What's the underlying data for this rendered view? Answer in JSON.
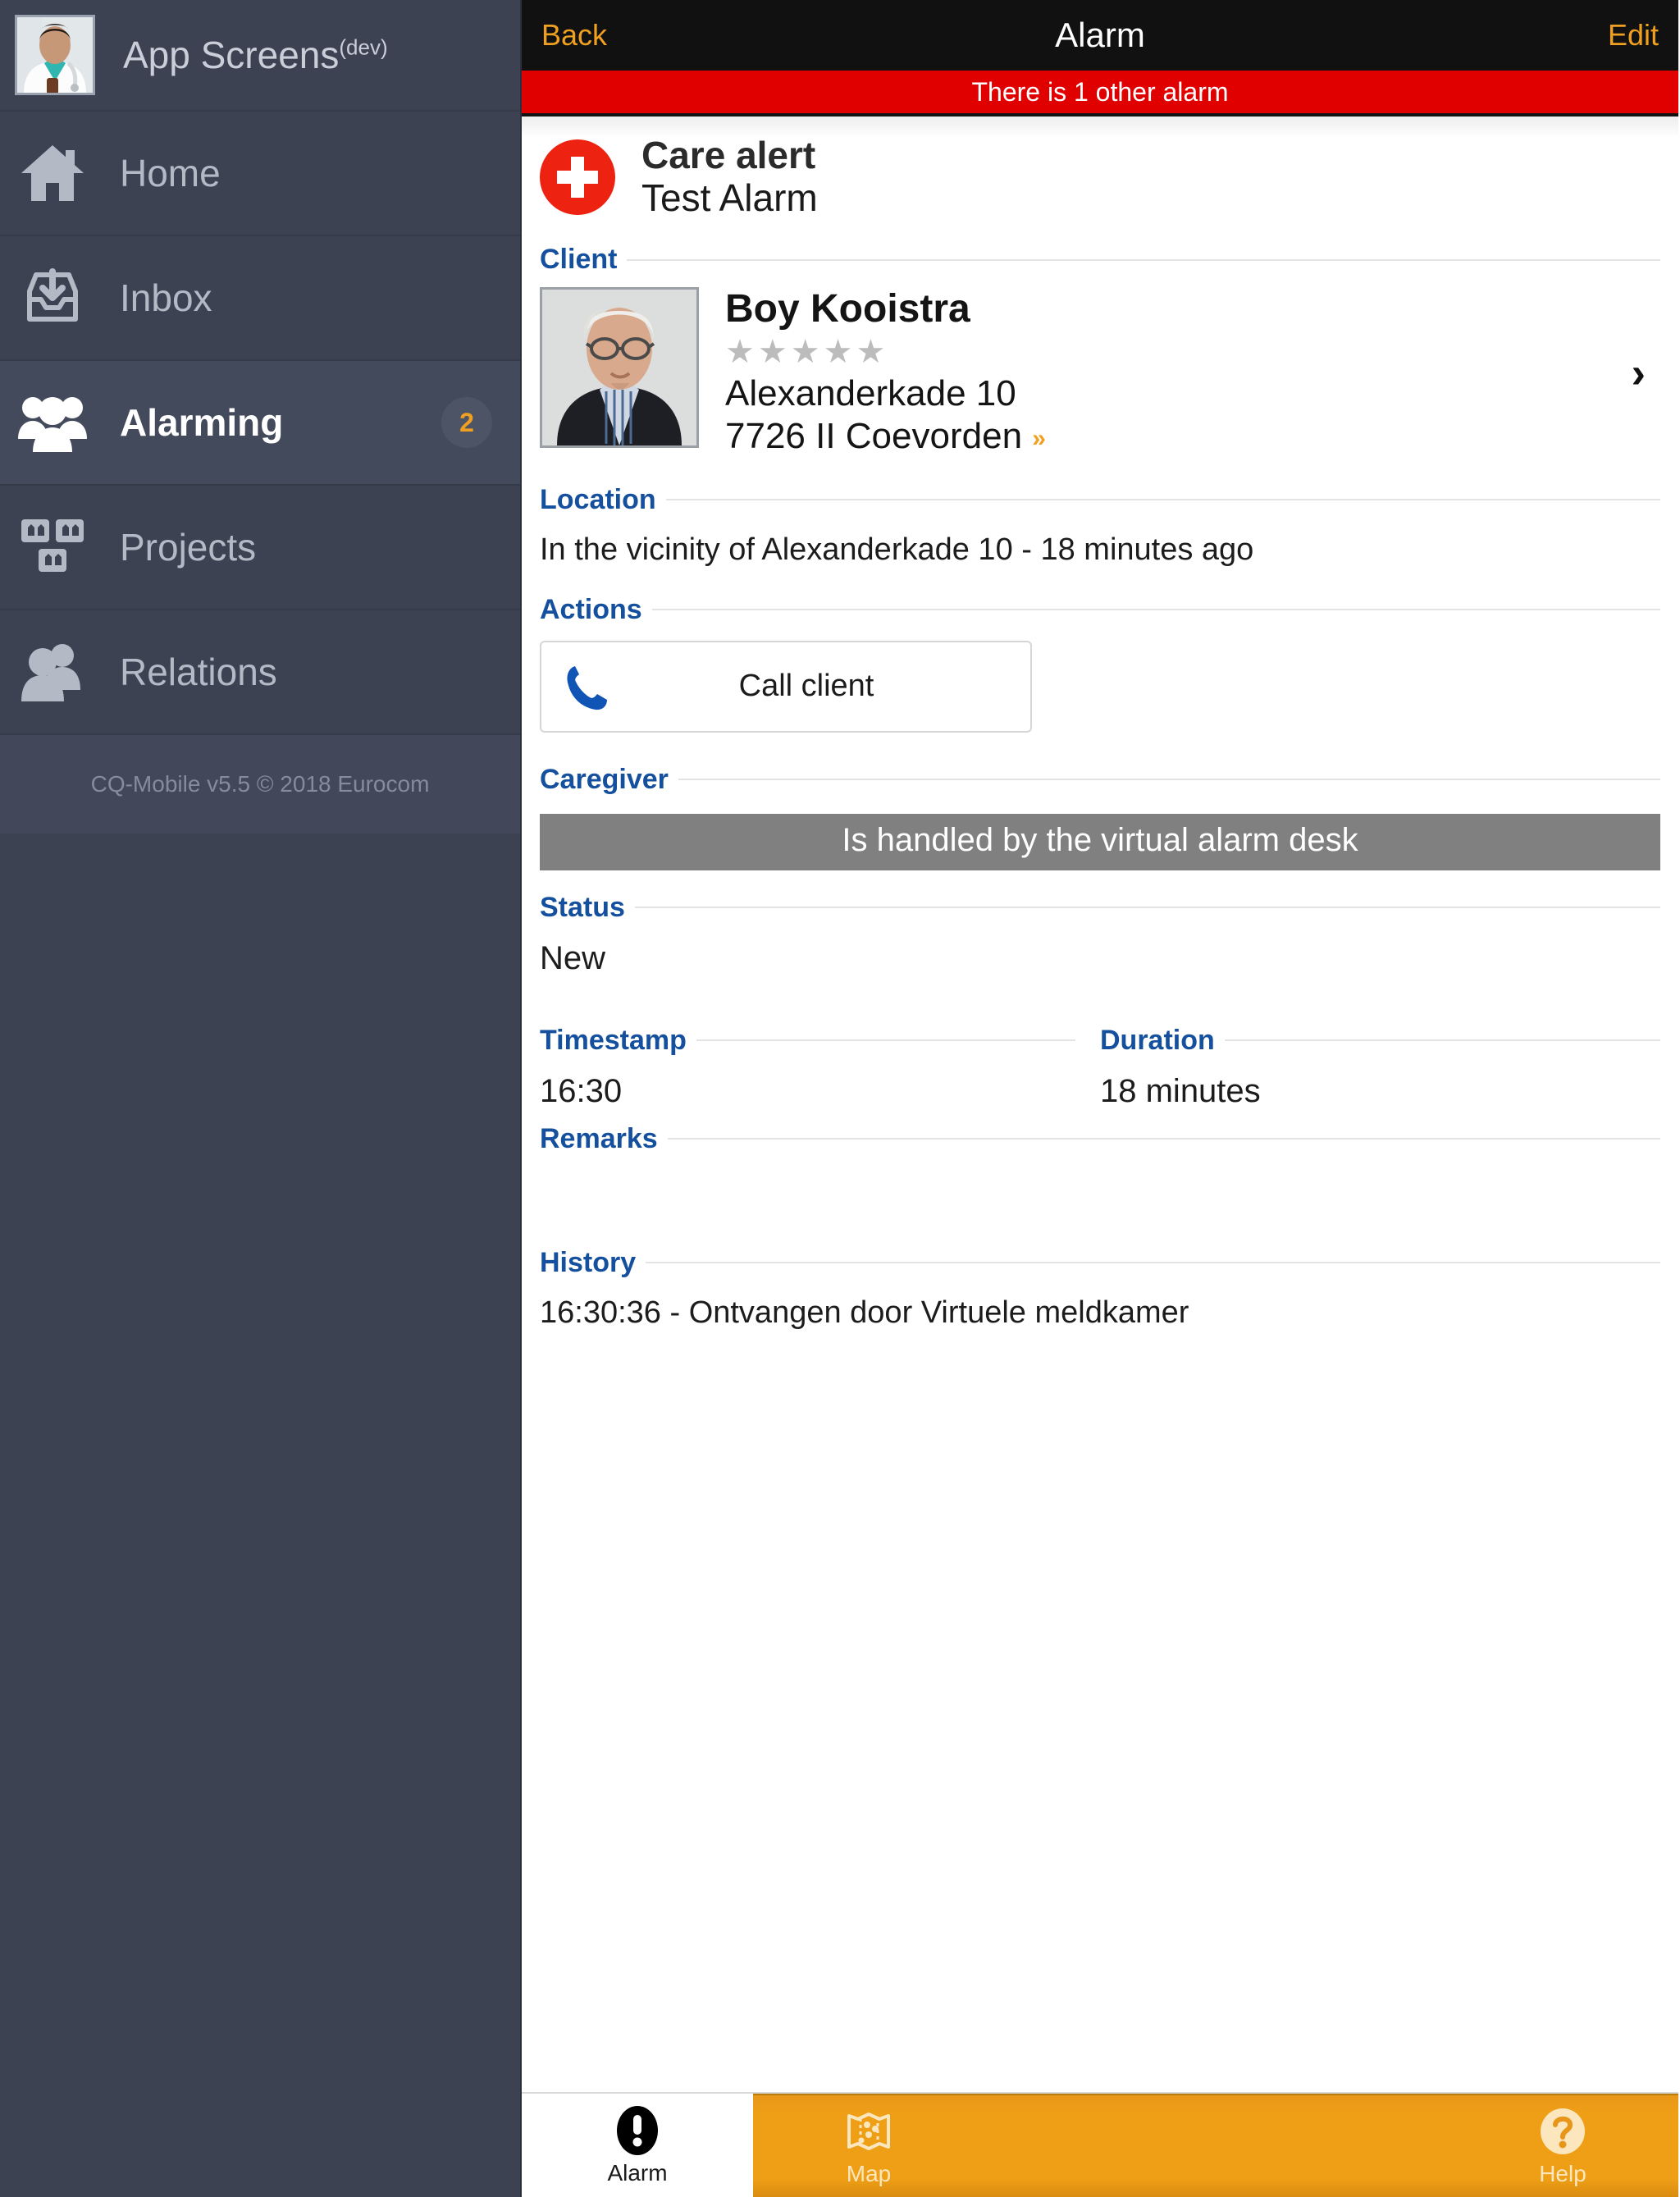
{
  "sidebar": {
    "app_title": "App Screens",
    "app_title_sup": "(dev)",
    "avatar_icon": "doctor-avatar-photo",
    "items": [
      {
        "label": "Home",
        "icon": "home-icon",
        "badge": "",
        "active": false
      },
      {
        "label": "Inbox",
        "icon": "inbox-icon",
        "badge": "",
        "active": false
      },
      {
        "label": "Alarming",
        "icon": "people-icon",
        "badge": "2",
        "active": true
      },
      {
        "label": "Projects",
        "icon": "projects-icon",
        "badge": "",
        "active": false
      },
      {
        "label": "Relations",
        "icon": "relations-icon",
        "badge": "",
        "active": false
      }
    ],
    "footer": "CQ-Mobile v5.5 © 2018 Eurocom"
  },
  "navbar": {
    "back_label": "Back",
    "title": "Alarm",
    "edit_label": "Edit",
    "back_icon": "back-text-button",
    "edit_icon": "edit-text-button"
  },
  "banner": {
    "text": "There is 1 other alarm",
    "color": "#e00000"
  },
  "alarm": {
    "icon": "red-cross-alert-icon",
    "type": "Care alert",
    "name": "Test Alarm"
  },
  "sections": {
    "client": "Client",
    "location": "Location",
    "actions": "Actions",
    "caregiver": "Caregiver",
    "status": "Status",
    "timestamp": "Timestamp",
    "duration": "Duration",
    "remarks": "Remarks",
    "history": "History"
  },
  "client": {
    "photo_icon": "client-portrait-photo",
    "name": "Boy Kooistra",
    "stars": "★★★★★",
    "rating": 0,
    "address_line1": "Alexanderkade 10",
    "address_line2": "7726 II Coevorden",
    "address_more": "»",
    "chevron": "›"
  },
  "location": {
    "text": "In the vicinity of Alexanderkade 10 - 18 minutes ago"
  },
  "actions": {
    "call_client_label": "Call client",
    "call_icon": "phone-icon"
  },
  "caregiver": {
    "text": "Is handled by the virtual alarm desk",
    "bar_color": "#808080"
  },
  "status": {
    "value": "New"
  },
  "timestamp": {
    "value": "16:30"
  },
  "duration": {
    "value": "18 minutes"
  },
  "remarks": {
    "value": ""
  },
  "history": {
    "entries": [
      "16:30:36 - Ontvangen door Virtuele meldkamer"
    ]
  },
  "tabbar": {
    "tabs": [
      {
        "label": "Alarm",
        "icon": "exclamation-circle-icon",
        "active": true
      },
      {
        "label": "Map",
        "icon": "map-icon",
        "active": false
      },
      {
        "label": "Help",
        "icon": "question-circle-icon",
        "active": false
      }
    ],
    "accent_color": "#ef9f16"
  }
}
